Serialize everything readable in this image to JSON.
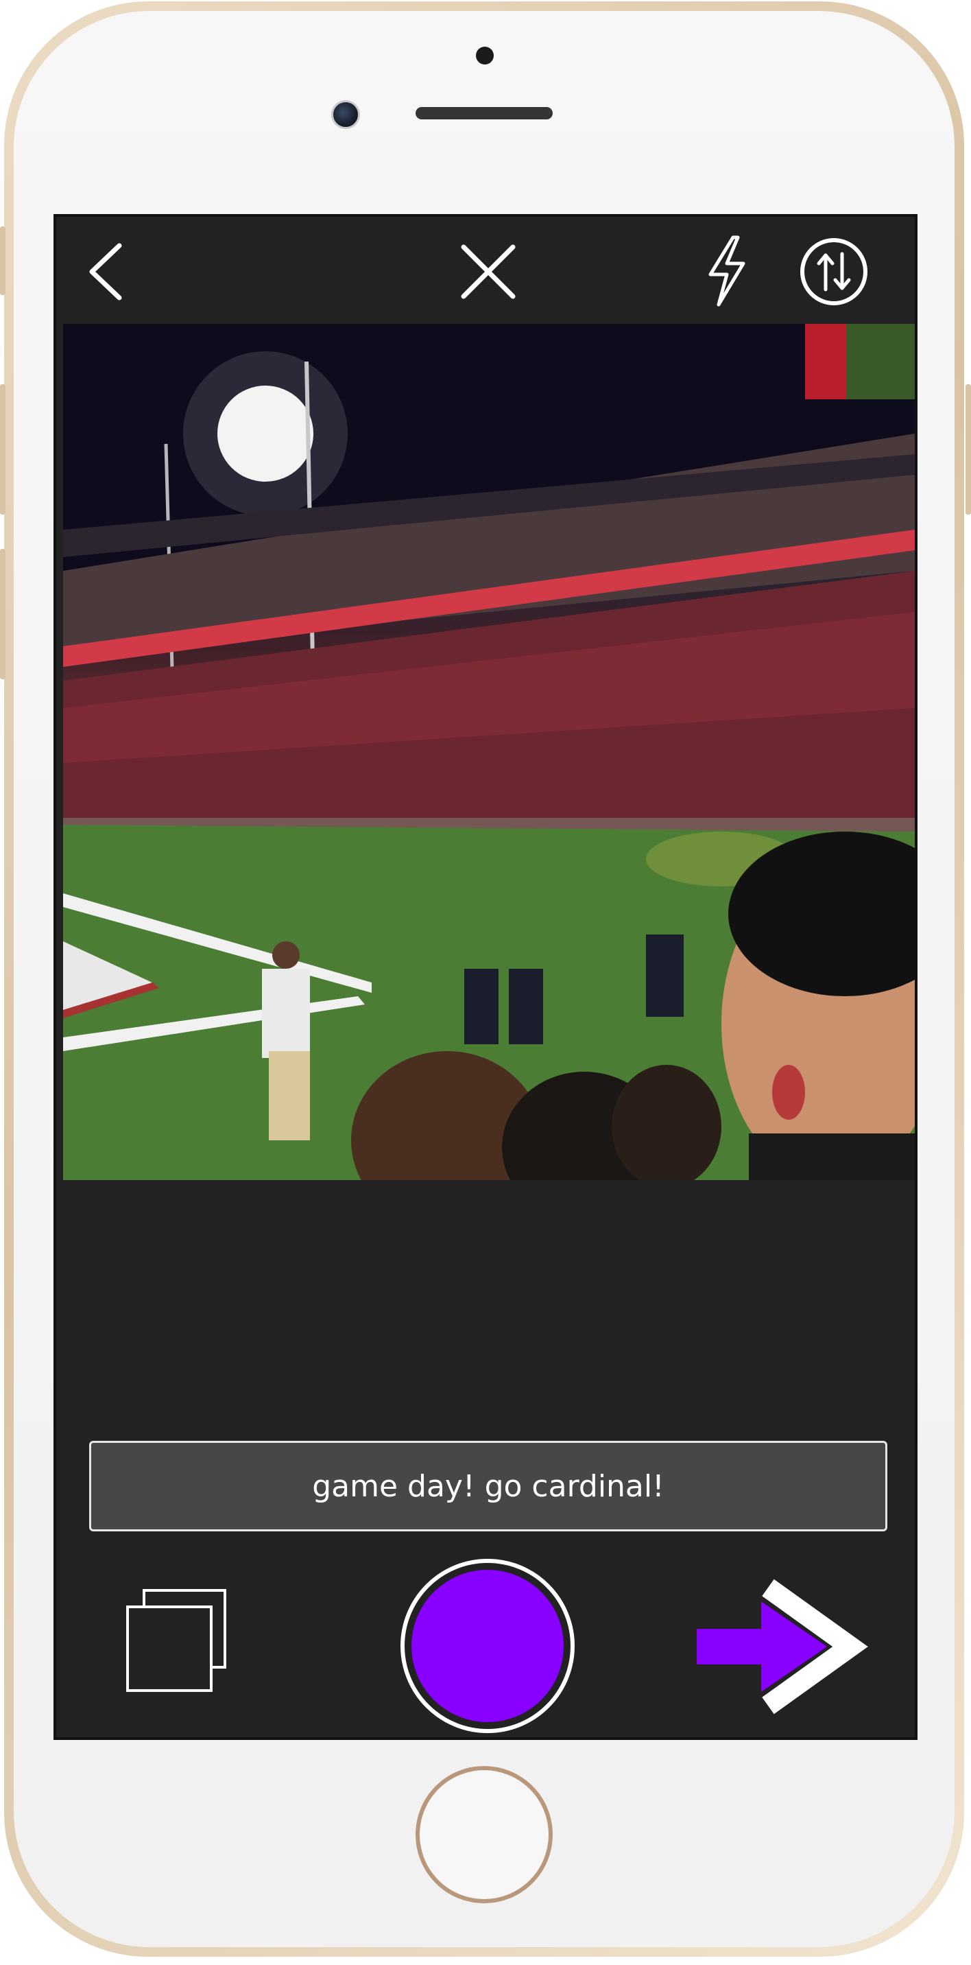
{
  "app": {
    "caption_text": "game day! go cardinal!",
    "accent_color": "#8800ff",
    "background_color": "#222222"
  },
  "toolbar": {
    "back_icon": "chevron-left-icon",
    "close_icon": "close-icon",
    "flash_icon": "lightning-icon",
    "settings_icon": "arrows-up-down-circle-icon"
  },
  "bottom_controls": {
    "gallery_icon": "stacked-squares-icon",
    "record_icon": "record-button",
    "send_icon": "arrow-right-icon"
  },
  "photo": {
    "description": "stadium-photo"
  }
}
